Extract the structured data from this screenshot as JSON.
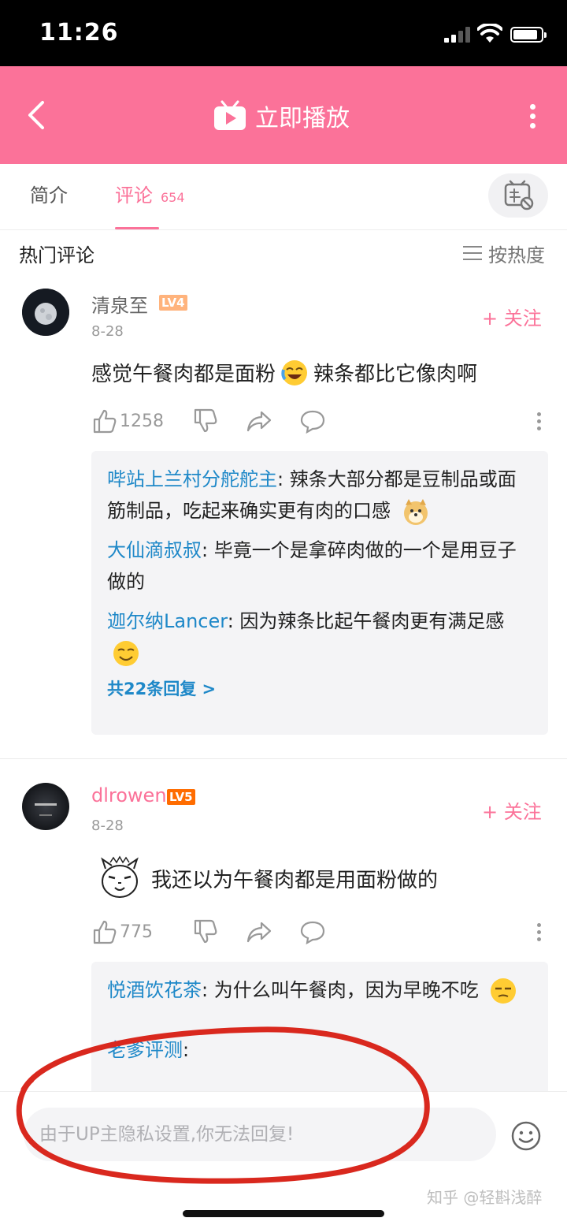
{
  "status_bar": {
    "time": "11:26"
  },
  "header": {
    "title": "立即播放"
  },
  "tabs": {
    "intro": "简介",
    "comments": "评论",
    "comments_count": "654"
  },
  "section": {
    "title": "热门评论",
    "sort": "按热度"
  },
  "comments": [
    {
      "user": "清泉至",
      "level": "LV4",
      "date": "8-28",
      "follow": "+ 关注",
      "text_before": "感觉午餐肉都是面粉",
      "text_after": "辣条都比它像肉啊",
      "likes": "1258",
      "replies": [
        {
          "user": "哔站上兰村分舵舵主",
          "text": ": 辣条大部分都是豆制品或面筋制品，吃起来确实更有肉的口感"
        },
        {
          "user": "大仙滴叔叔",
          "text": ": 毕竟一个是拿碎肉做的一个是用豆子做的"
        },
        {
          "user": "迦尔纳Lancer",
          "text": ": 因为辣条比起午餐肉更有满足感"
        }
      ],
      "more_replies": "共22条回复 >"
    },
    {
      "user": "dlrowen",
      "level": "LV5",
      "date": "8-28",
      "follow": "+ 关注",
      "text": "我还以为午餐肉都是用面粉做的",
      "likes": "775",
      "replies": [
        {
          "user": "悦酒饮花茶",
          "text": ": 为什么叫午餐肉，因为早晚不吃"
        },
        {
          "user": "老爹评测",
          "text": ":"
        }
      ]
    }
  ],
  "bottom": {
    "reply_placeholder": "由于UP主隐私设置,你无法回复!",
    "watermark": "知乎 @轻斟浅醉"
  },
  "colors": {
    "brand_pink": "#fb7299",
    "link_blue": "#1e88c8",
    "annotation_red": "#d9281e"
  }
}
